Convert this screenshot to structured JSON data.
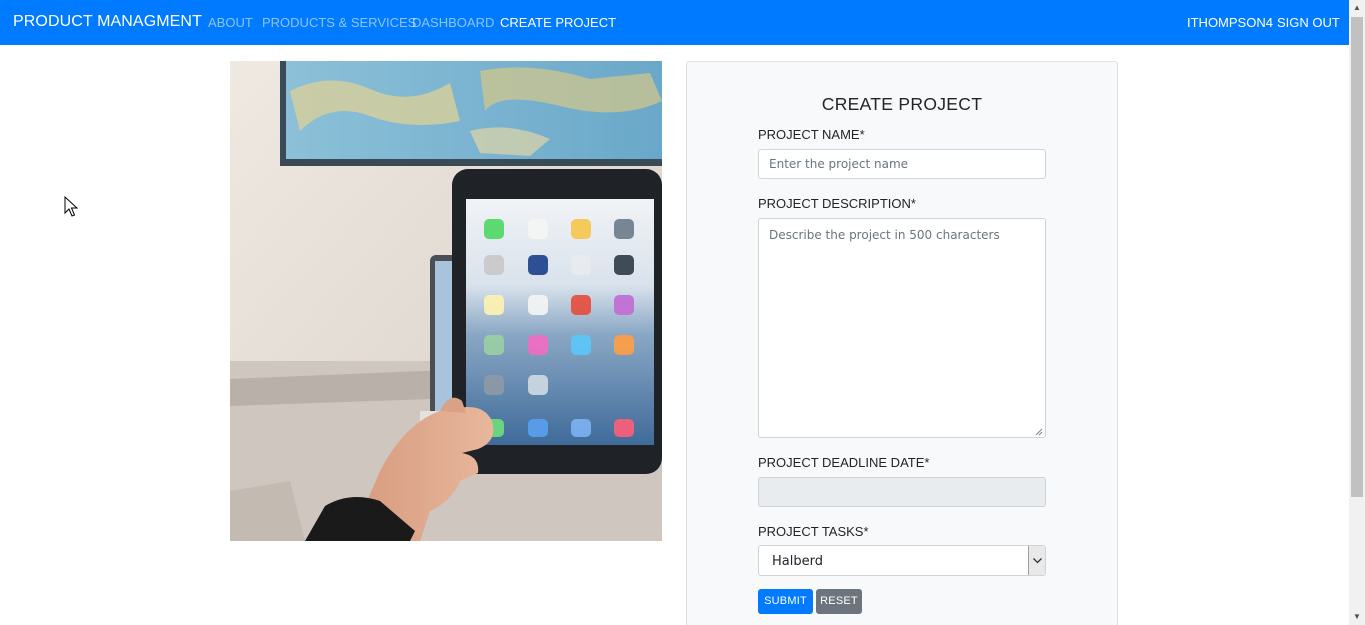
{
  "navbar": {
    "brand": "PRODUCT MANAGMENT",
    "links": [
      "ABOUT",
      "PRODUCTS & SERVICES",
      "DASHBOARD",
      "CREATE PROJECT"
    ],
    "active_link": "CREATE PROJECT",
    "user": "ITHOMPSON4",
    "sign_out": "SIGN OUT"
  },
  "form": {
    "title": "CREATE PROJECT",
    "name_label": "PROJECT NAME*",
    "name_placeholder": "Enter the project name",
    "name_value": "",
    "description_label": "PROJECT DESCRIPTION*",
    "description_placeholder": "Describe the project in 500 characters",
    "description_value": "",
    "deadline_label": "PROJECT DEADLINE DATE*",
    "deadline_value": "",
    "tasks_label": "PROJECT TASKS*",
    "tasks_selected": "Halberd",
    "submit_label": "SUBMIT",
    "reset_label": "RESET"
  },
  "colors": {
    "navbar_bg": "#007bff",
    "primary": "#007bff",
    "secondary": "#6c757d",
    "card_bg": "#f8f9fa"
  },
  "icons": {
    "photo": "hand-holding-tablet-photo",
    "cursor": "mouse-pointer-icon",
    "select_arrow": "chevron-down-icon"
  }
}
